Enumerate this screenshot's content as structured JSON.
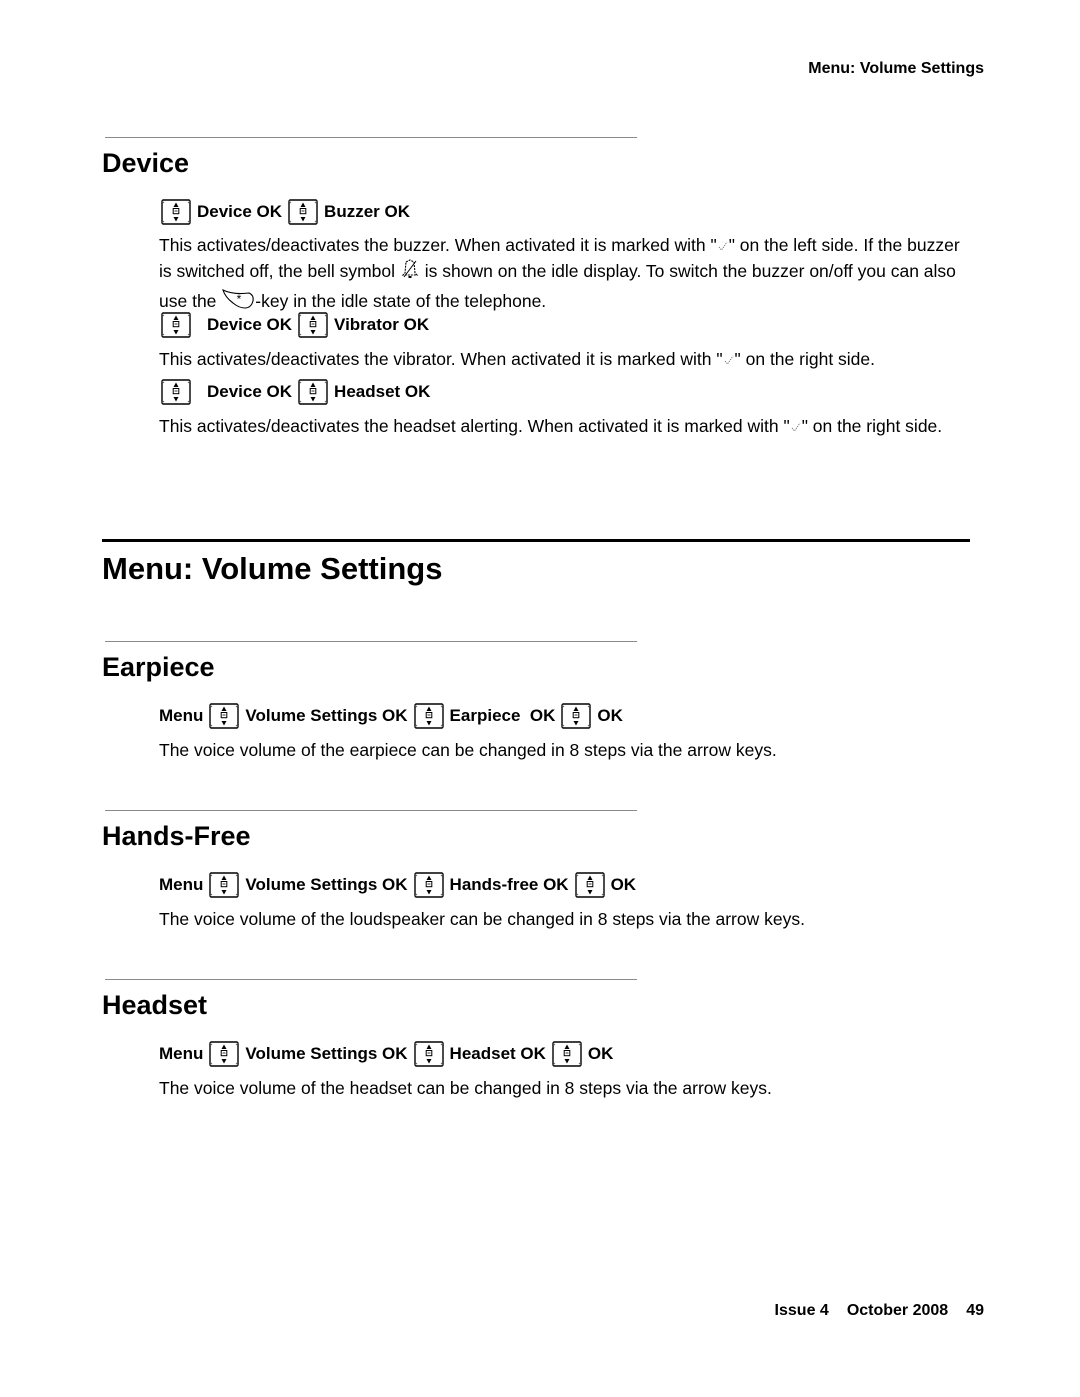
{
  "running_header": "Menu: Volume Settings",
  "sections": {
    "device": {
      "heading": "Device",
      "items": [
        {
          "path": [
            "Device OK",
            "Buzzer OK"
          ],
          "description_parts": [
            "This activates/deactivates the buzzer. When activated it is marked with \"",
            "\" on the left side. If the buzzer is switched off, the bell symbol ",
            " is shown on the idle display. To switch the buzzer on/off you can also use the ",
            "-key in the idle state of the telephone."
          ]
        },
        {
          "path": [
            "Device OK",
            "Vibrator OK"
          ],
          "description_parts": [
            "This activates/deactivates the vibrator. When activated it is marked with \"",
            "\" on the right side."
          ]
        },
        {
          "path": [
            "Device OK",
            "Headset OK"
          ],
          "description_parts": [
            "This activates/deactivates the headset alerting. When activated it is marked with \"",
            "\" on the right side."
          ]
        }
      ]
    },
    "main_heading": "Menu: Volume Settings",
    "earpiece": {
      "heading": "Earpiece",
      "path": [
        "Menu",
        "Volume Settings OK",
        "Earpiece  OK",
        "OK"
      ],
      "description": "The voice volume of the earpiece can be changed in 8 steps via the arrow keys."
    },
    "hands_free": {
      "heading": "Hands-Free",
      "path": [
        "Menu",
        "Volume Settings OK",
        "Hands-free OK",
        "OK"
      ],
      "description": "The voice volume of the loudspeaker can be changed in 8 steps via the arrow keys."
    },
    "headset": {
      "heading": "Headset",
      "path": [
        "Menu",
        "Volume Settings OK",
        "Headset OK",
        "OK"
      ],
      "description": "The voice volume of the headset can be changed in 8 steps via the arrow keys."
    }
  },
  "icons": {
    "navigation_key": "navigation-key-icon",
    "checkmark": "checkmark-icon",
    "bell_off": "bell-off-icon",
    "star_key": "star-key-icon"
  },
  "footer": {
    "issue": "Issue 4",
    "date": "October 2008",
    "page_number": "49"
  }
}
